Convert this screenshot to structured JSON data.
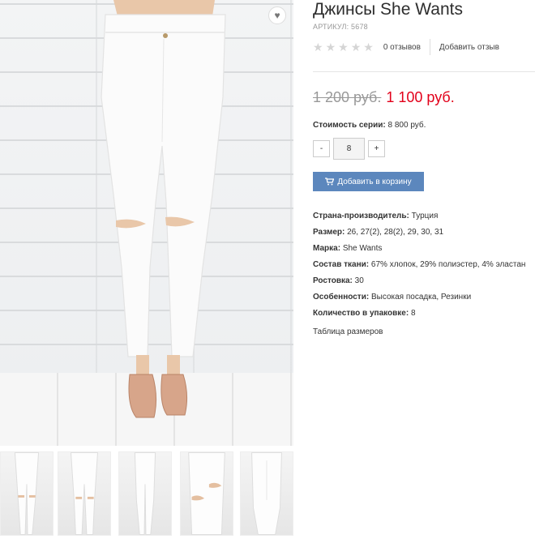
{
  "product": {
    "title": "Джинсы She Wants",
    "sku": "АРТИКУЛ: 5678",
    "rating_stars": 5,
    "reviews_count": "0 отзывов",
    "add_review": "Добавить отзыв",
    "old_price": "1 200 руб.",
    "new_price": "1 100 руб.",
    "series_label": "Стоимость серии:",
    "series_value": "8 800 руб.",
    "quantity": "8",
    "qty_minus": "-",
    "qty_plus": "+",
    "cart_label": "Добавить в корзину",
    "size_table": "Таблица размеров"
  },
  "specs": [
    {
      "label": "Страна-производитель:",
      "value": "Турция"
    },
    {
      "label": "Размер:",
      "value": "26, 27(2), 28(2), 29, 30, 31"
    },
    {
      "label": "Марка:",
      "value": "She Wants"
    },
    {
      "label": "Состав ткани:",
      "value": "67% хлопок, 29% полиэстер, 4% эластан"
    },
    {
      "label": "Ростовка:",
      "value": "30"
    },
    {
      "label": "Особенности:",
      "value": "Высокая посадка, Резинки"
    },
    {
      "label": "Количество в упаковке:",
      "value": "8"
    }
  ],
  "icons": {
    "wishlist": "heart-icon",
    "cart": "cart-icon",
    "star": "star-icon"
  },
  "colors": {
    "price_new": "#e2001a",
    "cart_button": "#5c87bd"
  }
}
